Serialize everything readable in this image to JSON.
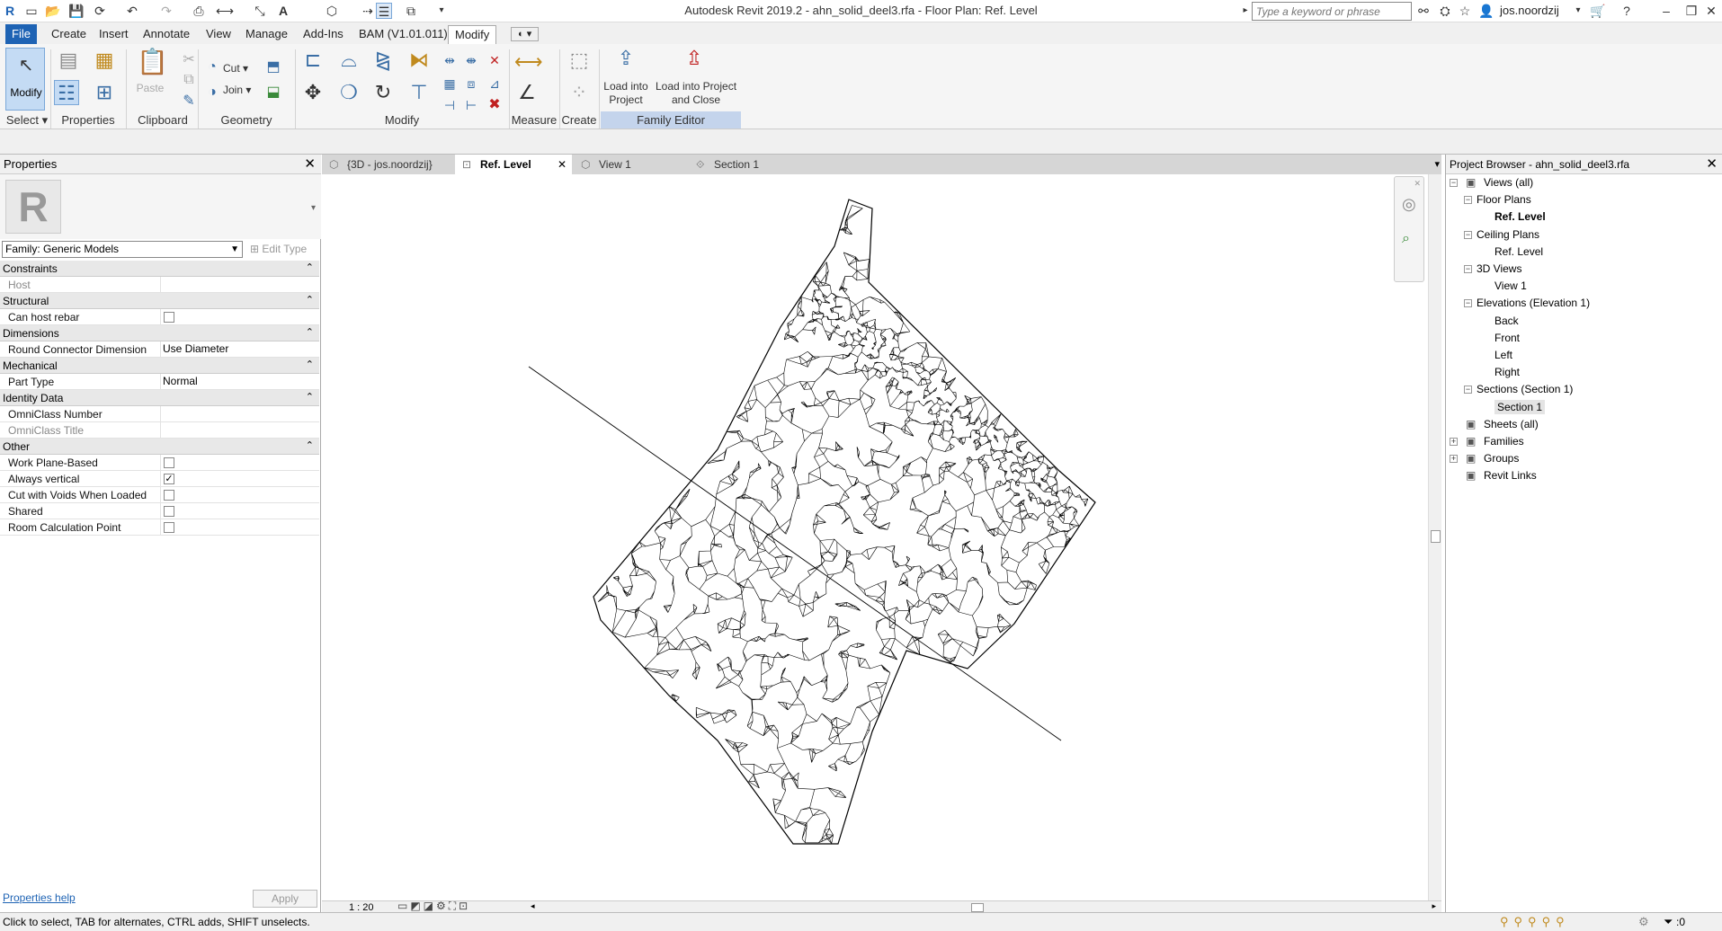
{
  "app": {
    "title": "Autodesk Revit 2019.2 - ahn_solid_deel3.rfa - Floor Plan: Ref. Level",
    "search_placeholder": "Type a keyword or phrase",
    "user": "jos.noordzij"
  },
  "menu": {
    "tabs": [
      "File",
      "Create",
      "Insert",
      "Annotate",
      "View",
      "Manage",
      "Add-Ins",
      "BAM (V1.01.011)",
      "Modify"
    ]
  },
  "ribbon": {
    "modify_label": "Modify",
    "cut_label": "Cut",
    "join_label": "Join",
    "paste_label": "Paste",
    "load_project": "Load into Project",
    "load_close": "Load into Project and Close",
    "panels": {
      "select": "Select",
      "properties": "Properties",
      "clipboard": "Clipboard",
      "geometry": "Geometry",
      "modify": "Modify",
      "measure": "Measure",
      "create": "Create",
      "family_editor": "Family Editor"
    }
  },
  "properties": {
    "title": "Properties",
    "family": "Family: Generic Models",
    "edit_type": "Edit Type",
    "groups": [
      {
        "name": "Constraints",
        "rows": [
          {
            "key": "Host",
            "value": "",
            "grey": true
          }
        ]
      },
      {
        "name": "Structural",
        "rows": [
          {
            "key": "Can host rebar",
            "check": false
          }
        ]
      },
      {
        "name": "Dimensions",
        "rows": [
          {
            "key": "Round Connector Dimension",
            "value": "Use Diameter"
          }
        ]
      },
      {
        "name": "Mechanical",
        "rows": [
          {
            "key": "Part Type",
            "value": "Normal"
          }
        ]
      },
      {
        "name": "Identity Data",
        "rows": [
          {
            "key": "OmniClass Number",
            "value": ""
          },
          {
            "key": "OmniClass Title",
            "value": "",
            "grey": true
          }
        ]
      },
      {
        "name": "Other",
        "rows": [
          {
            "key": "Work Plane-Based",
            "check": false
          },
          {
            "key": "Always vertical",
            "check": true
          },
          {
            "key": "Cut with Voids When Loaded",
            "check": false
          },
          {
            "key": "Shared",
            "check": false
          },
          {
            "key": "Room Calculation Point",
            "check": false
          }
        ]
      }
    ],
    "help": "Properties help",
    "apply": "Apply"
  },
  "views": {
    "tabs": [
      {
        "label": "{3D - jos.noordzij}",
        "active": false,
        "close": false
      },
      {
        "label": "Ref. Level",
        "active": true,
        "close": true
      },
      {
        "label": "View 1",
        "active": false,
        "close": false
      },
      {
        "label": "Section 1",
        "active": false,
        "close": false
      }
    ],
    "scale": "1 : 20"
  },
  "browser": {
    "title": "Project Browser - ahn_solid_deel3.rfa",
    "nodes": [
      {
        "label": "Views (all)",
        "depth": 0,
        "toggle": "−",
        "icon": true
      },
      {
        "label": "Floor Plans",
        "depth": 1,
        "toggle": "−"
      },
      {
        "label": "Ref. Level",
        "depth": 2,
        "bold": true
      },
      {
        "label": "Ceiling Plans",
        "depth": 1,
        "toggle": "−"
      },
      {
        "label": "Ref. Level",
        "depth": 2
      },
      {
        "label": "3D Views",
        "depth": 1,
        "toggle": "−"
      },
      {
        "label": "View 1",
        "depth": 2
      },
      {
        "label": "Elevations (Elevation 1)",
        "depth": 1,
        "toggle": "−"
      },
      {
        "label": "Back",
        "depth": 2
      },
      {
        "label": "Front",
        "depth": 2
      },
      {
        "label": "Left",
        "depth": 2
      },
      {
        "label": "Right",
        "depth": 2
      },
      {
        "label": "Sections (Section 1)",
        "depth": 1,
        "toggle": "−"
      },
      {
        "label": "Section 1",
        "depth": 2,
        "selected": true
      },
      {
        "label": "Sheets (all)",
        "depth": 0,
        "icon": true
      },
      {
        "label": "Families",
        "depth": 0,
        "toggle": "+",
        "icon": true
      },
      {
        "label": "Groups",
        "depth": 0,
        "toggle": "+",
        "icon": true
      },
      {
        "label": "Revit Links",
        "depth": 0,
        "icon": true
      }
    ]
  },
  "status": {
    "text": "Click to select, TAB for alternates, CTRL adds, SHIFT unselects.",
    "filter_count": ":0"
  }
}
